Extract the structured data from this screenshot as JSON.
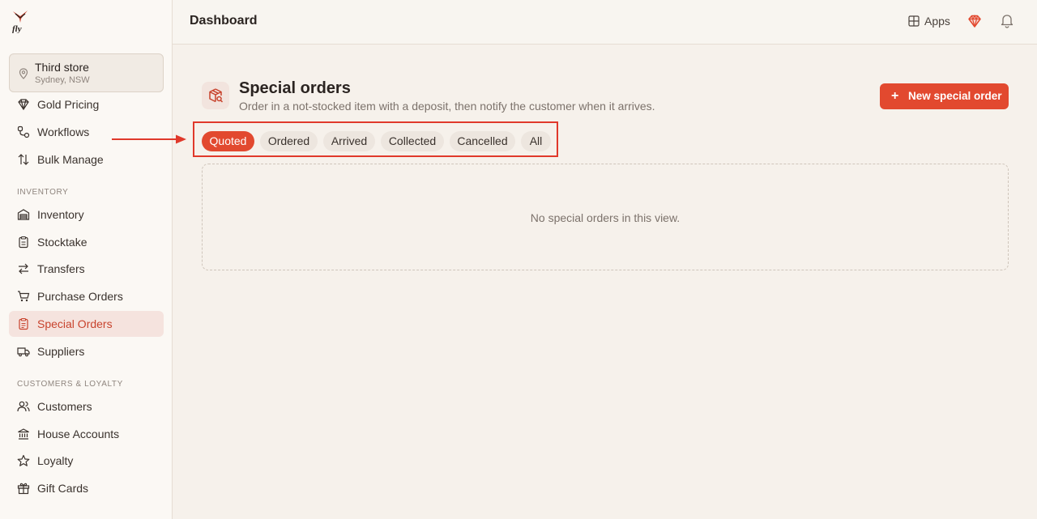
{
  "header": {
    "title": "Dashboard",
    "apps_label": "Apps"
  },
  "store": {
    "name": "Third store",
    "location": "Sydney, NSW"
  },
  "sidebar": {
    "items": [
      {
        "label": "Gold Pricing",
        "icon": "gem-icon"
      },
      {
        "label": "Workflows",
        "icon": "workflow-icon"
      },
      {
        "label": "Bulk Manage",
        "icon": "sort-arrows-icon"
      },
      {
        "label": "Inventory",
        "icon": "warehouse-icon"
      },
      {
        "label": "Stocktake",
        "icon": "clipboard-icon"
      },
      {
        "label": "Transfers",
        "icon": "transfer-arrows-icon"
      },
      {
        "label": "Purchase Orders",
        "icon": "cart-icon"
      },
      {
        "label": "Special Orders",
        "icon": "clipboard-list-icon",
        "active": true
      },
      {
        "label": "Suppliers",
        "icon": "truck-icon"
      },
      {
        "label": "Customers",
        "icon": "users-icon"
      },
      {
        "label": "House Accounts",
        "icon": "bank-icon"
      },
      {
        "label": "Loyalty",
        "icon": "star-icon"
      },
      {
        "label": "Gift Cards",
        "icon": "gift-icon"
      }
    ],
    "sections": {
      "inventory": "INVENTORY",
      "customers": "CUSTOMERS & LOYALTY"
    }
  },
  "main": {
    "title": "Special orders",
    "subtitle": "Order in a not-stocked item with a deposit, then notify the customer when it arrives.",
    "new_button": "New special order",
    "tabs": [
      "Quoted",
      "Ordered",
      "Arrived",
      "Collected",
      "Cancelled",
      "All"
    ],
    "active_tab": "Quoted",
    "empty_text": "No special orders in this view."
  },
  "colors": {
    "accent": "#e2492f",
    "highlight_box": "#e0392b",
    "background": "#f6f1eb"
  }
}
